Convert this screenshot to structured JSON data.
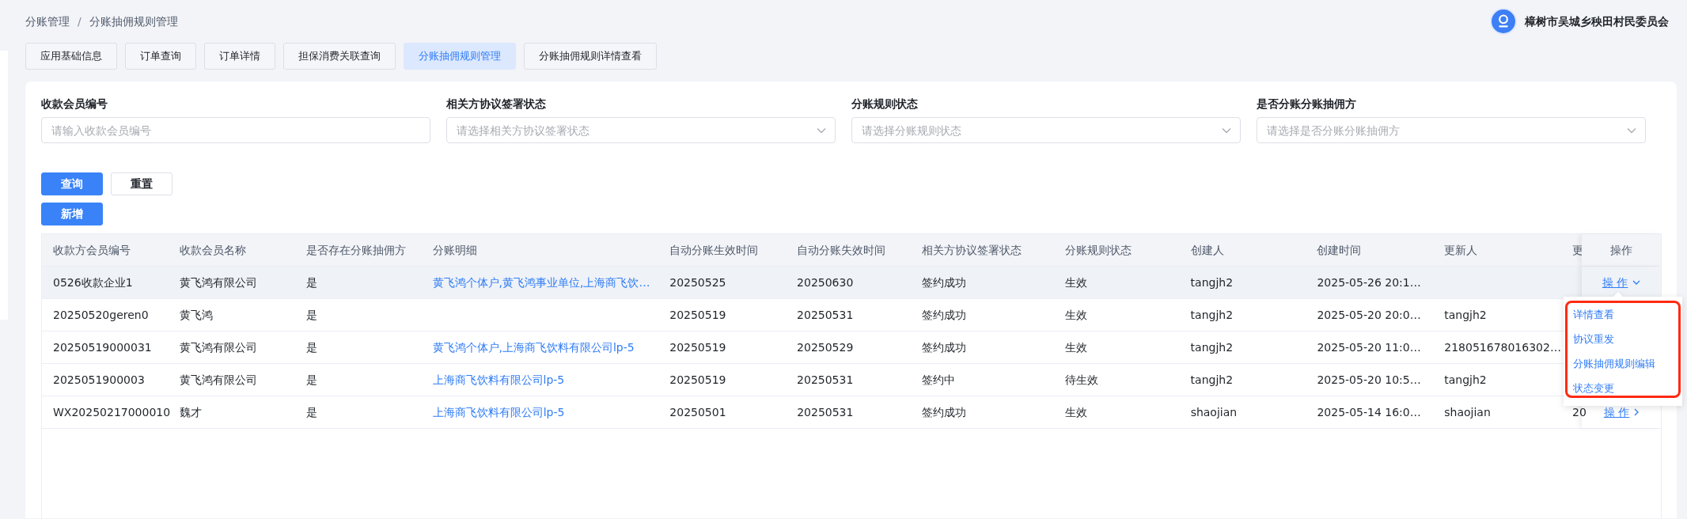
{
  "breadcrumb": {
    "items": [
      "分账管理",
      "分账抽佣规则管理"
    ],
    "separator": "/"
  },
  "user": {
    "name": "樟树市吴城乡秧田村民委员会"
  },
  "tabs": [
    {
      "label": "应用基础信息",
      "selected": false
    },
    {
      "label": "订单查询",
      "selected": false
    },
    {
      "label": "订单详情",
      "selected": false
    },
    {
      "label": "担保消费关联查询",
      "selected": false
    },
    {
      "label": "分账抽佣规则管理",
      "selected": true
    },
    {
      "label": "分账抽佣规则详情查看",
      "selected": false
    }
  ],
  "filters": [
    {
      "label": "收款会员编号",
      "kind": "input",
      "placeholder": "请输入收款会员编号"
    },
    {
      "label": "相关方协议签署状态",
      "kind": "select",
      "placeholder": "请选择相关方协议签署状态"
    },
    {
      "label": "分账规则状态",
      "kind": "select",
      "placeholder": "请选择分账规则状态"
    },
    {
      "label": "是否分账分账抽佣方",
      "kind": "select",
      "placeholder": "请选择是否分账分账抽佣方"
    }
  ],
  "buttons": [
    {
      "label": "查询",
      "kind": "primary"
    },
    {
      "label": "重置",
      "kind": "default"
    }
  ],
  "add_button": {
    "label": "新增"
  },
  "table": {
    "columns": [
      {
        "label": "收款方会员编号",
        "kind": "text"
      },
      {
        "label": "收款会员名称",
        "kind": "text"
      },
      {
        "label": "是否存在分账抽佣方",
        "kind": "text"
      },
      {
        "label": "分账明细",
        "kind": "link"
      },
      {
        "label": "自动分账生效时间",
        "kind": "text"
      },
      {
        "label": "自动分账失效时间",
        "kind": "text"
      },
      {
        "label": "相关方协议签署状态",
        "kind": "text"
      },
      {
        "label": "分账规则状态",
        "kind": "text"
      },
      {
        "label": "创建人",
        "kind": "text"
      },
      {
        "label": "创建时间",
        "kind": "text"
      },
      {
        "label": "更新人",
        "kind": "text"
      },
      {
        "label": "更",
        "kind": "text"
      }
    ],
    "action_column": "操作",
    "rows": [
      {
        "hovered": true,
        "cells": [
          "0526收款企业1",
          "黄飞鸿有限公司",
          "是",
          "黄飞鸿个体户,黄飞鸿事业单位,上海商飞饮…",
          "20250525",
          "20250630",
          "签约成功",
          "生效",
          "tangjh2",
          "2025-05-26 20:1…",
          null,
          null
        ],
        "action": {
          "label": "操 作",
          "expanded": true
        }
      },
      {
        "hovered": false,
        "cells": [
          "20250520geren0",
          "黄飞鸿",
          "是",
          null,
          "20250519",
          "20250531",
          "签约成功",
          "生效",
          "tangjh2",
          "2025-05-20 20:0…",
          "tangjh2",
          null
        ]
      },
      {
        "hovered": false,
        "cells": [
          "20250519000031",
          "黄飞鸿有限公司",
          "是",
          "黄飞鸿个体户,上海商飞饮料有限公司lp-5",
          "20250519",
          "20250529",
          "签约成功",
          "生效",
          "tangjh2",
          "2025-05-20 11:0…",
          "218051678016302…",
          null
        ]
      },
      {
        "hovered": false,
        "cells": [
          "2025051900003",
          "黄飞鸿有限公司",
          "是",
          "上海商飞饮料有限公司lp-5",
          "20250519",
          "20250531",
          "签约中",
          "待生效",
          "tangjh2",
          "2025-05-20 10:5…",
          "tangjh2",
          null
        ]
      },
      {
        "hovered": false,
        "cells": [
          "WX20250217000010",
          "魏才",
          "是",
          "上海商飞饮料有限公司lp-5",
          "20250501",
          "20250531",
          "签约成功",
          "生效",
          "shaojian",
          "2025-05-14 16:0…",
          "shaojian",
          "20"
        ],
        "action": {
          "label": "操 作",
          "expanded": false
        }
      }
    ]
  },
  "action_menu": {
    "items": [
      "详情查看",
      "协议重发",
      "分账抽佣规则编辑",
      "状态变更"
    ],
    "highlight_frame": true
  }
}
